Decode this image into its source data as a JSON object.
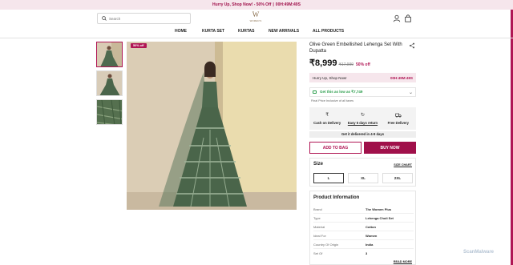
{
  "announcement": {
    "text": "Hurry Up, Shop Now! - 50% Off",
    "separator": "|",
    "timer": "00H:49M:49S"
  },
  "header": {
    "search_placeholder": "Search",
    "logo_mark": "W",
    "logo_text": "WOMEN'S",
    "icons": [
      "search-icon",
      "user-icon",
      "bag-icon"
    ]
  },
  "nav": {
    "items": [
      "HOME",
      "KURTA SET",
      "KURTAS",
      "NEW ARRIVALS",
      "ALL PRODUCTS"
    ]
  },
  "gallery": {
    "badge": "50% off"
  },
  "product": {
    "title": "Olive Green Embellished Lehenga Set With Dupatta",
    "price": "₹8,999",
    "mrp": "₹17,999",
    "discount": "50% off"
  },
  "hurry": {
    "text": "Hurry Up, Shop Now!",
    "timer": "00H:49M:49S"
  },
  "offer": {
    "text": "Get this as low as ₹7,749",
    "tax_note": "Final Price Inclusive of all taxes"
  },
  "features": [
    {
      "icon": "rupee-icon",
      "label": "Cash on Delivery"
    },
    {
      "icon": "return-icon",
      "label": "Easy 5 days return"
    },
    {
      "icon": "truck-icon",
      "label": "Free Delivery"
    }
  ],
  "delivery": "Get it delivered in 4-9 days",
  "actions": {
    "add_to_bag": "ADD TO BAG",
    "buy_now": "BUY NOW"
  },
  "size": {
    "heading": "Size",
    "chart_label": "SIZE CHART",
    "options": [
      "L",
      "XL",
      "2XL"
    ],
    "selected": "L"
  },
  "info": {
    "heading": "Product Information",
    "rows": [
      {
        "k": "Brand",
        "v": "The Women Plus"
      },
      {
        "k": "Type",
        "v": "Lehenga Choli Set"
      },
      {
        "k": "Material",
        "v": "Cotton"
      },
      {
        "k": "Ideal For",
        "v": "Women"
      },
      {
        "k": "Country Of Origin",
        "v": "India"
      },
      {
        "k": "Set Of",
        "v": "3"
      }
    ],
    "read_more": "READ MORE"
  },
  "watermark": "ScanMalware",
  "colors": {
    "accent": "#b01654",
    "accent_dark": "#a0104a",
    "announce_bg": "#f6e6ec",
    "green": "#2a9d4b"
  }
}
